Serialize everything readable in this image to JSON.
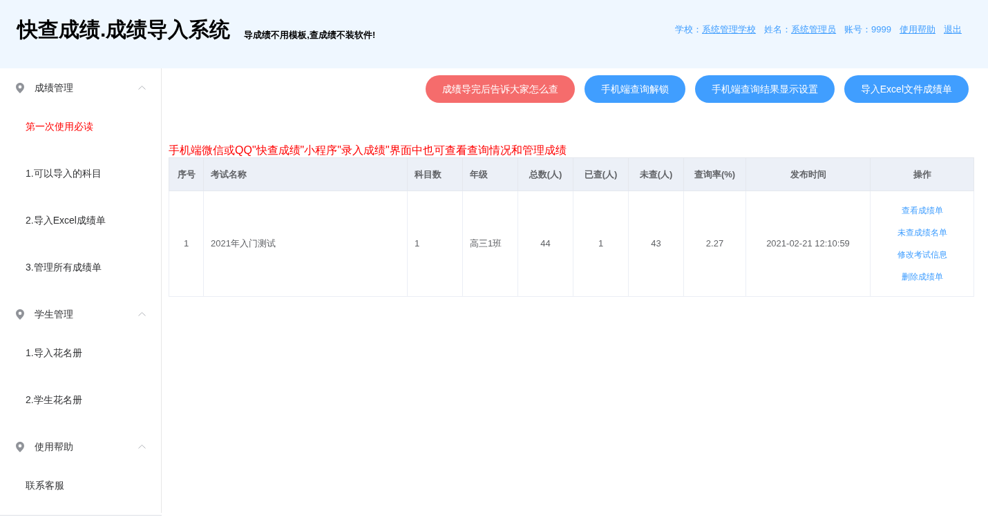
{
  "header": {
    "title": "快查成绩.成绩导入系统",
    "slogan": "导成绩不用模板,查成绩不装软件!",
    "account": [
      {
        "label": "学校：",
        "value": "系统管理学校",
        "kind": "link"
      },
      {
        "label": "姓名：",
        "value": "系统管理员",
        "kind": "link"
      },
      {
        "label": "账号：",
        "value": "9999",
        "kind": "text"
      }
    ],
    "links": [
      "使用帮助",
      "退出"
    ]
  },
  "sidebar": {
    "groups": [
      {
        "label": "成绩管理",
        "expanded": true,
        "items": [
          {
            "label": "第一次使用必读",
            "selected": true
          },
          {
            "label": "1.可以导入的科目",
            "selected": false
          },
          {
            "label": "2.导入Excel成绩单",
            "selected": false
          },
          {
            "label": "3.管理所有成绩单",
            "selected": false
          }
        ]
      },
      {
        "label": "学生管理",
        "expanded": true,
        "items": [
          {
            "label": "1.导入花名册",
            "selected": false
          },
          {
            "label": "2.学生花名册",
            "selected": false
          }
        ]
      },
      {
        "label": "使用帮助",
        "expanded": true,
        "items": [
          {
            "label": "联系客服",
            "selected": false
          }
        ]
      }
    ]
  },
  "actions": [
    {
      "label": "成绩导完后告诉大家怎么查",
      "kind": "danger"
    },
    {
      "label": "手机端查询解锁",
      "kind": "primary"
    },
    {
      "label": "手机端查询结果显示设置",
      "kind": "primary"
    },
    {
      "label": "导入Excel文件成绩单",
      "kind": "primary"
    }
  ],
  "notice": "手机端微信或QQ\"快查成绩\"小程序\"录入成绩\"界面中也可查看查询情况和管理成绩",
  "table": {
    "columns": [
      "序号",
      "考试名称",
      "科目数",
      "年级",
      "总数(人)",
      "已查(人)",
      "未查(人)",
      "查询率(%)",
      "发布时间",
      "操作"
    ],
    "rows": [
      {
        "cells": [
          "1",
          "2021年入门测试",
          "1",
          "高三1班",
          "44",
          "1",
          "43",
          "2.27",
          "2021-02-21 12:10:59"
        ],
        "actions": [
          "查看成绩单",
          "未查成绩名单",
          "修改考试信息",
          "删除成绩单"
        ]
      }
    ]
  }
}
